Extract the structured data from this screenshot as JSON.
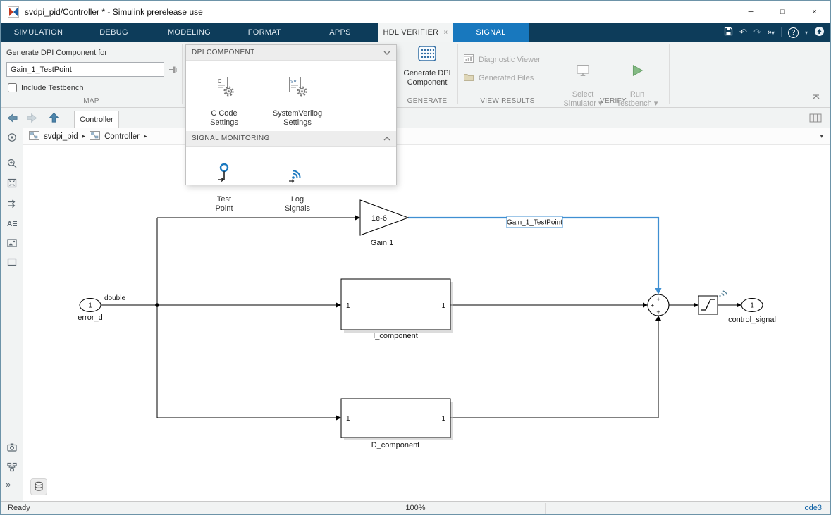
{
  "window": {
    "title": "svdpi_pid/Controller * - Simulink prerelease use",
    "controls": {
      "minimize": "─",
      "maximize": "□",
      "close": "×"
    }
  },
  "icons": {
    "tab_close": "×",
    "breadcrumb_sep": "▸",
    "breadcrumb_dropdown": "▾",
    "undo": "↶",
    "redo": "↷",
    "overflow": "»",
    "caret_down": "▾",
    "help": "?",
    "more": "»"
  },
  "tabs": [
    {
      "label": "SIMULATION"
    },
    {
      "label": "DEBUG"
    },
    {
      "label": "MODELING"
    },
    {
      "label": "FORMAT"
    },
    {
      "label": "APPS"
    },
    {
      "label": "HDL VERIFIER"
    },
    {
      "label": "SIGNAL"
    }
  ],
  "ribbon": {
    "map": {
      "label": "Generate DPI Component for",
      "input_value": "Gain_1_TestPoint",
      "checkbox_label": "Include Testbench",
      "section": "MAP"
    },
    "generate": {
      "button_label": "Generate DPI\nComponent",
      "section": "GENERATE"
    },
    "view_results": {
      "items": [
        {
          "label": "Diagnostic Viewer"
        },
        {
          "label": "Generated Files"
        }
      ],
      "section": "VIEW RESULTS"
    },
    "verify": {
      "select_simulator": "Select\nSimulator ▾",
      "run_testbench": "Run\nTestbench ▾",
      "section": "VERIFY"
    }
  },
  "panel": {
    "dpi_header": "DPI COMPONENT",
    "dpi_items": [
      {
        "label": "C Code\nSettings"
      },
      {
        "label": "SystemVerilog\nSettings"
      }
    ],
    "monitor_header": "SIGNAL MONITORING",
    "monitor_items": [
      {
        "label": "Test\nPoint"
      },
      {
        "label": "Log\nSignals"
      }
    ]
  },
  "nav": {
    "doc_tab": "Controller"
  },
  "breadcrumb": {
    "items": [
      {
        "label": "svdpi_pid"
      },
      {
        "label": "Controller"
      }
    ]
  },
  "diagram": {
    "inport": {
      "num": "1",
      "label": "error_d",
      "type_label": "double"
    },
    "gain": {
      "value": "1e-6",
      "label": "Gain 1"
    },
    "test_point_label": "Gain_1_TestPoint",
    "i_component": {
      "label": "I_component",
      "in": "1",
      "out": "1"
    },
    "d_component": {
      "label": "D_component",
      "in": "1",
      "out": "1"
    },
    "sum": {
      "p1": "+",
      "p2": "+",
      "p3": "+"
    },
    "outport": {
      "num": "1",
      "label": "control_signal"
    }
  },
  "status": {
    "ready": "Ready",
    "zoom": "100%",
    "solver": "ode3"
  }
}
